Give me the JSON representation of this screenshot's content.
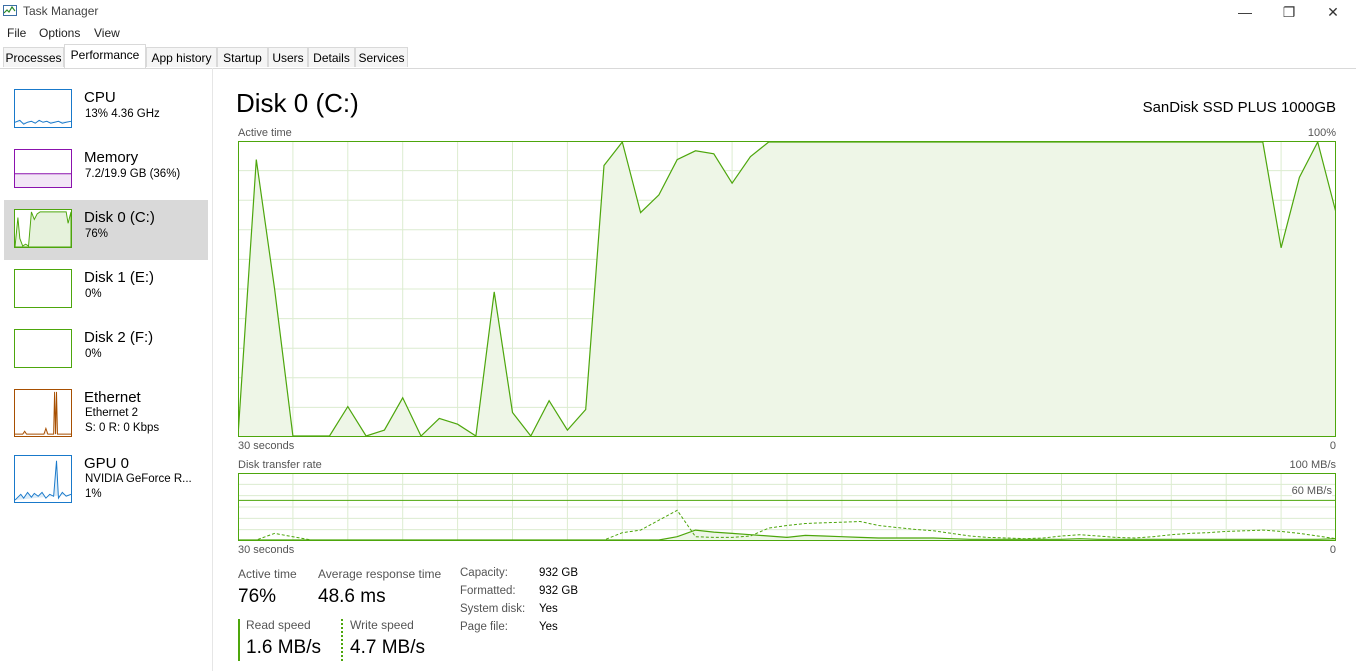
{
  "window": {
    "title": "Task Manager",
    "minimize_glyph": "—",
    "maximize_glyph": "❐",
    "close_glyph": "✕"
  },
  "menu": [
    "File",
    "Options",
    "View"
  ],
  "tabs": [
    "Processes",
    "Performance",
    "App history",
    "Startup",
    "Users",
    "Details",
    "Services"
  ],
  "sidebar": {
    "items": [
      {
        "name": "CPU",
        "sub1": "13%  4.36 GHz",
        "sub2": "",
        "color": "#1979ca"
      },
      {
        "name": "Memory",
        "sub1": "7.2/19.9 GB (36%)",
        "sub2": "",
        "color": "#8b12ae"
      },
      {
        "name": "Disk 0 (C:)",
        "sub1": "76%",
        "sub2": "",
        "color": "#4da60c"
      },
      {
        "name": "Disk 1 (E:)",
        "sub1": "0%",
        "sub2": "",
        "color": "#4da60c"
      },
      {
        "name": "Disk 2 (F:)",
        "sub1": "0%",
        "sub2": "",
        "color": "#4da60c"
      },
      {
        "name": "Ethernet",
        "sub1": "Ethernet 2",
        "sub2": "S: 0  R: 0 Kbps",
        "color": "#a74f01"
      },
      {
        "name": "GPU 0",
        "sub1": "NVIDIA GeForce R...",
        "sub2": "1%",
        "color": "#1979ca"
      }
    ]
  },
  "main": {
    "title": "Disk 0 (C:)",
    "device": "SanDisk SSD PLUS 1000GB",
    "active_graph": {
      "label": "Active time",
      "max_label": "100%",
      "left_label": "30 seconds",
      "right_label": "0",
      "values": [
        0,
        94,
        50,
        0,
        0,
        0,
        10,
        0,
        2,
        13,
        0,
        6,
        4,
        0,
        49,
        8,
        0,
        12,
        2,
        9,
        92,
        100,
        76,
        82,
        94,
        97,
        96,
        86,
        95,
        100,
        100,
        100,
        100,
        100,
        100,
        100,
        100,
        100,
        100,
        100,
        100,
        100,
        100,
        100,
        100,
        100,
        100,
        100,
        100,
        100,
        100,
        100,
        100,
        100,
        100,
        100,
        100,
        64,
        88,
        100,
        76
      ]
    },
    "transfer_graph": {
      "label": "Disk transfer rate",
      "max_label": "100 MB/s",
      "line_label": "60 MB/s",
      "left_label": "30 seconds",
      "right_label": "0",
      "read_values": [
        0,
        0,
        0,
        0,
        0,
        0,
        0,
        0,
        0,
        0,
        0,
        0,
        0,
        0,
        0,
        0,
        0,
        0,
        0,
        0,
        0,
        0,
        0,
        0,
        5,
        15,
        12,
        10,
        8,
        6,
        4,
        7,
        6,
        5,
        4,
        3,
        3,
        3,
        3,
        2,
        1,
        1,
        1,
        1,
        1,
        1,
        2,
        1,
        1,
        1,
        1,
        1,
        1,
        1,
        1,
        1,
        1,
        1,
        1,
        1,
        2
      ],
      "write_values": [
        0,
        0,
        10,
        5,
        0,
        0,
        0,
        0,
        0,
        0,
        0,
        0,
        0,
        0,
        0,
        0,
        0,
        0,
        0,
        0,
        0,
        11,
        15,
        30,
        45,
        5,
        4,
        4,
        6,
        18,
        22,
        25,
        26,
        27,
        28,
        22,
        19,
        16,
        14,
        10,
        6,
        4,
        3,
        2,
        3,
        6,
        8,
        6,
        4,
        3,
        5,
        8,
        10,
        11,
        13,
        14,
        15,
        13,
        10,
        6,
        2
      ]
    },
    "stats": {
      "active_time": {
        "label": "Active time",
        "value": "76%"
      },
      "avg_response": {
        "label": "Average response time",
        "value": "48.6 ms"
      },
      "read_speed": {
        "label": "Read speed",
        "value": "1.6 MB/s"
      },
      "write_speed": {
        "label": "Write speed",
        "value": "4.7 MB/s"
      }
    },
    "properties": [
      {
        "label": "Capacity:",
        "value": "932 GB"
      },
      {
        "label": "Formatted:",
        "value": "932 GB"
      },
      {
        "label": "System disk:",
        "value": "Yes"
      },
      {
        "label": "Page file:",
        "value": "Yes"
      }
    ]
  }
}
